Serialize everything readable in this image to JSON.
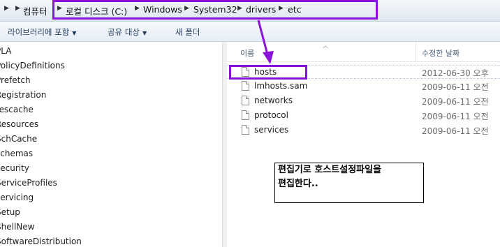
{
  "address_bar": {
    "crumbs": [
      "컴퓨터",
      "로컬 디스크 (C:)",
      "Windows",
      "System32",
      "drivers",
      "etc"
    ],
    "highlight_color": "#8a12d8"
  },
  "toolbar": {
    "include_library_label": "라이브러리에 포함",
    "share_with_label": "공유 대상",
    "new_folder_label": "새 폴더"
  },
  "nav_tree": {
    "items": [
      "PLA",
      "PolicyDefinitions",
      "Prefetch",
      "Registration",
      "rescache",
      "Resources",
      "SchCache",
      "schemas",
      "security",
      "ServiceProfiles",
      "servicing",
      "Setup",
      "ShellNew",
      "SoftwareDistribution"
    ]
  },
  "file_list": {
    "columns": {
      "name": "이름",
      "date_modified": "수정한 날짜"
    },
    "files": [
      {
        "name": "hosts",
        "date": "2012-06-30 오후",
        "selected": true
      },
      {
        "name": "lmhosts.sam",
        "date": "2009-06-11 오전"
      },
      {
        "name": "networks",
        "date": "2009-06-11 오전"
      },
      {
        "name": "protocol",
        "date": "2009-06-11 오전"
      },
      {
        "name": "services",
        "date": "2009-06-11 오전"
      }
    ]
  },
  "annotation": {
    "line1": "편집기로 호스트설정파일을",
    "line2": "편집한다..",
    "arrow_color": "#8a12d8"
  }
}
